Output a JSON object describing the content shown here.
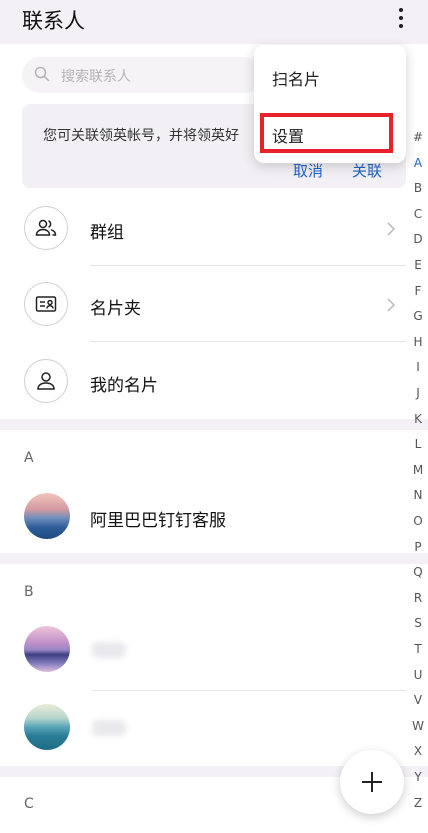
{
  "header": {
    "title": "联系人"
  },
  "search": {
    "placeholder": "搜索联系人"
  },
  "banner": {
    "text": "您可关联领英帐号，并将领英好",
    "cancel_label": "取消",
    "link_label": "关联"
  },
  "menu": {
    "items": [
      "扫名片",
      "设置"
    ],
    "highlighted_item": "设置"
  },
  "rows": [
    {
      "label": "群组",
      "icon": "group-icon",
      "has_chevron": true
    },
    {
      "label": "名片夹",
      "icon": "business-card-icon",
      "has_chevron": true
    },
    {
      "label": "我的名片",
      "icon": "person-icon",
      "has_chevron": false
    }
  ],
  "sections": [
    {
      "letter": "A",
      "contacts": [
        {
          "name": "阿里巴巴钉钉客服"
        }
      ]
    },
    {
      "letter": "B",
      "contacts": [
        {
          "name": ""
        },
        {
          "name": ""
        }
      ]
    },
    {
      "letter": "C",
      "contacts": []
    }
  ],
  "index": {
    "letters": [
      "#",
      "A",
      "B",
      "C",
      "D",
      "E",
      "F",
      "G",
      "H",
      "I",
      "J",
      "K",
      "L",
      "M",
      "N",
      "O",
      "P",
      "Q",
      "R",
      "S",
      "T",
      "U",
      "V",
      "W",
      "X",
      "Y",
      "Z"
    ],
    "active": "A"
  },
  "colors": {
    "accent": "#1f63c4",
    "highlight_box": "#e8212a",
    "background": "#f3f1f5"
  }
}
